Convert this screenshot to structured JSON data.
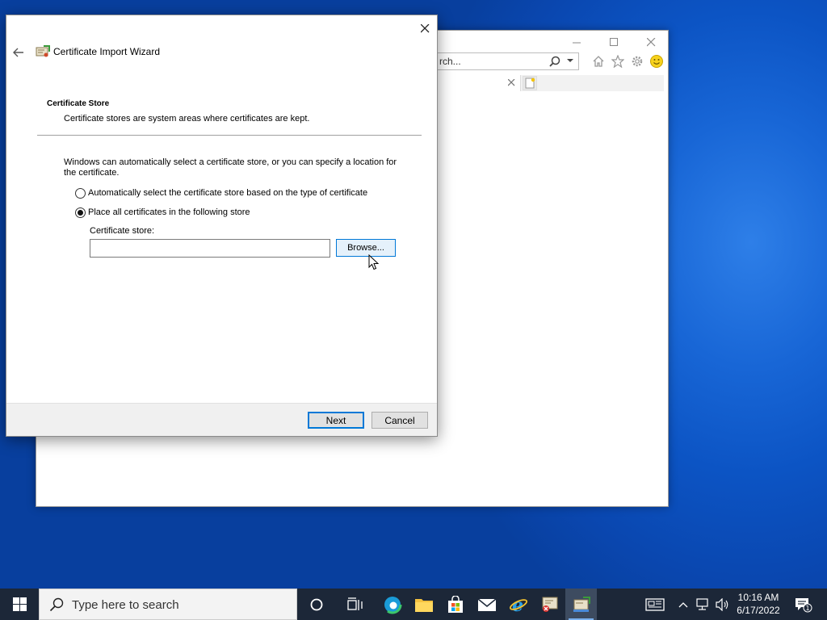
{
  "ie_window": {
    "address_text": "rch...",
    "controls": {
      "minimize": "—",
      "maximize": "☐",
      "close": "✕"
    }
  },
  "dialog": {
    "title": "Certificate Import Wizard",
    "section_title": "Certificate Store",
    "section_description": "Certificate stores are system areas where certificates are kept.",
    "intro": "Windows can automatically select a certificate store, or you can specify a location for the certificate.",
    "options": [
      {
        "label": "Automatically select the certificate store based on the type of certificate",
        "checked": false
      },
      {
        "label": "Place all certificates in the following store",
        "checked": true
      }
    ],
    "store_label": "Certificate store:",
    "store_value": "",
    "browse_label": "Browse...",
    "next_label": "Next",
    "cancel_label": "Cancel"
  },
  "taskbar": {
    "search_placeholder": "Type here to search",
    "time": "10:16 AM",
    "date": "6/17/2022",
    "notification_count": "1"
  },
  "colors": {
    "accent": "#0078d7",
    "desktop": "#0c54c4",
    "taskbar": "#1c2738"
  }
}
